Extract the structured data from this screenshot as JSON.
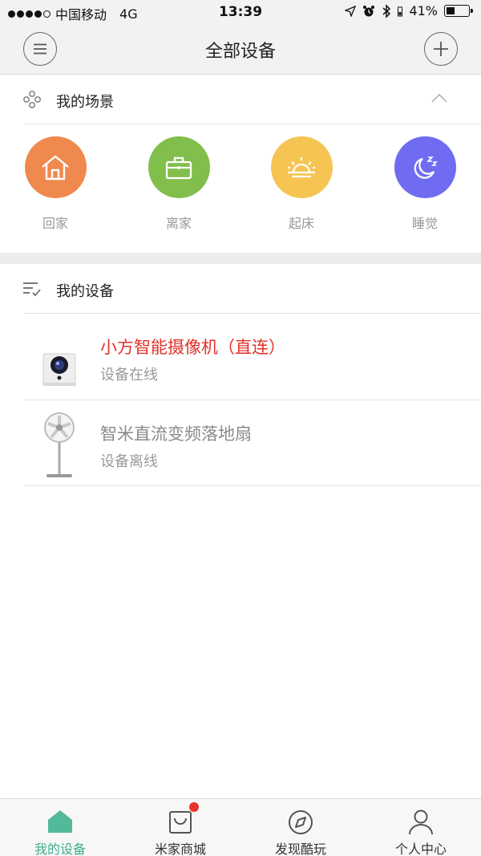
{
  "status_bar": {
    "carrier": "中国移动",
    "network": "4G",
    "time": "13:39",
    "battery_text": "41%",
    "battery_level": 0.41,
    "signal_bars": 4,
    "signal_max": 5
  },
  "header": {
    "title": "全部设备",
    "menu_icon": "menu-icon",
    "add_icon": "plus-icon"
  },
  "scenes_section": {
    "title": "我的场景",
    "icon": "scenes-icon",
    "collapse_icon": "chevron-up-icon",
    "items": [
      {
        "label": "回家",
        "icon": "home-icon",
        "color": "#f0894e"
      },
      {
        "label": "离家",
        "icon": "briefcase-icon",
        "color": "#82be4b"
      },
      {
        "label": "起床",
        "icon": "sunrise-icon",
        "color": "#f6c453"
      },
      {
        "label": "睡觉",
        "icon": "moon-icon",
        "color": "#6f6cf2"
      }
    ]
  },
  "devices_section": {
    "title": "我的设备",
    "icon": "device-list-icon",
    "items": [
      {
        "name": "小方智能摄像机（直连）",
        "status": "设备在线",
        "name_color": "#e0322a",
        "thumb": "camera"
      },
      {
        "name": "智米直流变频落地扇",
        "status": "设备离线",
        "name_color": "#8a8a8a",
        "thumb": "fan"
      }
    ]
  },
  "tab_bar": {
    "tabs": [
      {
        "label": "我的设备",
        "icon": "home-tab-icon",
        "active": true
      },
      {
        "label": "米家商城",
        "icon": "shopping-bag-icon",
        "active": false,
        "badge": true
      },
      {
        "label": "发现酷玩",
        "icon": "compass-icon",
        "active": false
      },
      {
        "label": "个人中心",
        "icon": "user-icon",
        "active": false
      }
    ]
  },
  "colors": {
    "accent": "#3fae8f",
    "online_red": "#e0322a",
    "badge_red": "#e8312a"
  }
}
